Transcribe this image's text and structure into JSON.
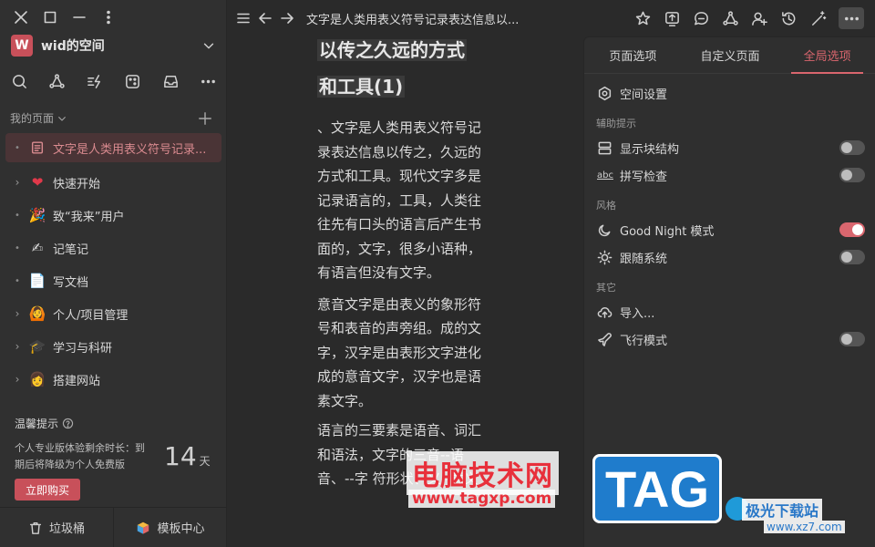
{
  "sidebar": {
    "space": {
      "avatar": "W",
      "name": "wid的空间"
    },
    "my_pages_label": "我的页面",
    "items": [
      {
        "label": "文字是人类用表义符号记录...",
        "emoji": "doc",
        "active": true
      },
      {
        "label": "快速开始",
        "emoji": "❤"
      },
      {
        "label": "致“我来”用户",
        "emoji": "🎉"
      },
      {
        "label": "记笔记",
        "emoji": "✍"
      },
      {
        "label": "写文档",
        "emoji": "📄"
      },
      {
        "label": "个人/项目管理",
        "emoji": "🙆"
      },
      {
        "label": "学习与科研",
        "emoji": "🎓"
      },
      {
        "label": "搭建网站",
        "emoji": "👩"
      }
    ],
    "tip": {
      "title": "温馨提示",
      "text": "个人专业版体验剩余时长：到期后将降级为个人免费版",
      "days": "14",
      "unit": "天",
      "buy": "立即购买"
    },
    "footer": {
      "trash": "垃圾桶",
      "templates": "模板中心"
    }
  },
  "topbar": {
    "breadcrumb": "文字是人类用表义符号记录表达信息以..."
  },
  "editor": {
    "heading_line1": "以传之久远的方式",
    "heading_line2": "和工具(1)",
    "para1": "、文字是人类用表义符号记录表达信息以传之，久远的方式和工具。现代文字多是记录语言的，工具，人类往往先有口头的语言后产生书面的，文字，很多小语种，有语言但没有文字。",
    "para2": "意音文字是由表义的象形符号和表音的声旁组。成的文字，汉字是由表形文字进化成的意音文字，汉字也是语素文字。",
    "para3": "语言的三要素是语音、词汇和语法，文字的三音--语音、--字 符形状、义--意义"
  },
  "panel": {
    "tabs": [
      "页面选项",
      "自定义页面",
      "全局选项"
    ],
    "active_tab": 2,
    "space_settings": "空间设置",
    "sec_assist": "辅助提示",
    "show_blocks": "显示块结构",
    "spell_check": "拼写检查",
    "sec_style": "风格",
    "good_night": "Good Night 模式",
    "follow_system": "跟随系统",
    "sec_other": "其它",
    "import": "导入...",
    "flight_mode": "飞行模式",
    "toggles": {
      "show_blocks": false,
      "spell_check": false,
      "good_night": true,
      "follow_system": false,
      "flight_mode": false
    }
  },
  "watermark": {
    "brand": "电脑技术网",
    "url": "www.tagxp.com",
    "tag": "TAG",
    "site": "极光下载站",
    "site_url": "www.xz7.com"
  },
  "colors": {
    "accent": "#d9666e",
    "avatar": "#c8505a",
    "background": "#2a2a2a"
  }
}
